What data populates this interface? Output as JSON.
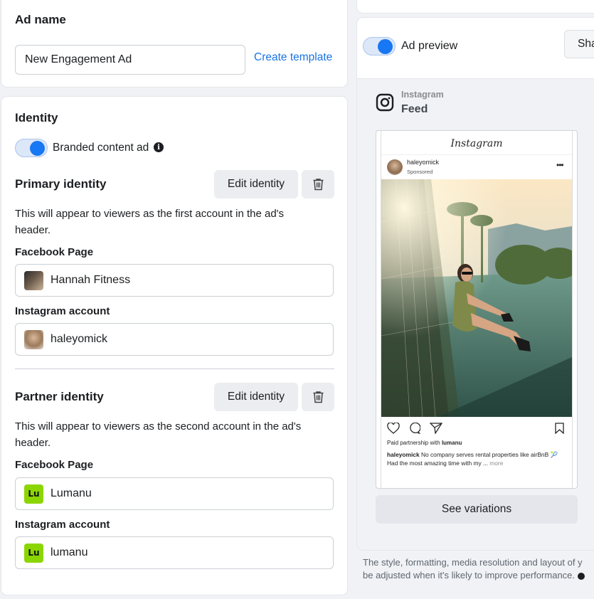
{
  "ad_name": {
    "heading": "Ad name",
    "value": "New Engagement Ad",
    "create_template": "Create template"
  },
  "identity": {
    "heading": "Identity",
    "branded_toggle_label": "Branded content ad",
    "branded_toggle_on": true,
    "primary": {
      "title": "Primary identity",
      "edit_label": "Edit identity",
      "description": "This will appear to viewers as the first account in the ad's header.",
      "facebook_label": "Facebook Page",
      "facebook_value": "Hannah Fitness",
      "instagram_label": "Instagram account",
      "instagram_value": "haleyomick"
    },
    "partner": {
      "title": "Partner identity",
      "edit_label": "Edit identity",
      "description": "This will appear to viewers as the second account in the ad's header.",
      "facebook_label": "Facebook Page",
      "facebook_value": "Lumanu",
      "facebook_logo": "Lu",
      "instagram_label": "Instagram account",
      "instagram_value": "lumanu",
      "instagram_logo": "Lu"
    }
  },
  "preview": {
    "toggle_label": "Ad preview",
    "toggle_on": true,
    "share_label": "Sha",
    "platform": "Instagram",
    "placement": "Feed",
    "ig_wordmark": "Instagram",
    "username": "haleyomick",
    "sponsored": "Sponsored",
    "partnership_prefix": "Paid partnership with ",
    "partnership_name": "lumanu",
    "caption_user": "haleyomick",
    "caption_text": " No company serves rental properties like airBnB 🎾 Had the most amazing time with my ...",
    "caption_more": " more",
    "see_variations": "See variations",
    "footer_text_1": "The style, formatting, media resolution and layout of y",
    "footer_text_2": "be adjusted when it's likely to improve performance."
  },
  "colors": {
    "accent": "#1877f2",
    "link": "#1b74e4",
    "lumanu_green": "#8bd600"
  }
}
